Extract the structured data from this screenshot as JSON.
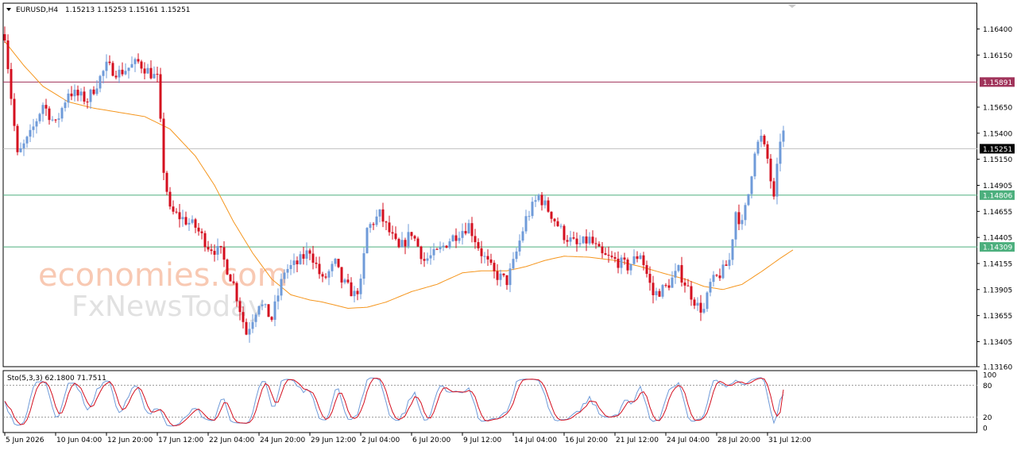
{
  "header": {
    "symbol": "EURUSD,H4",
    "ohlc": "1.15213 1.15253 1.15161 1.15251"
  },
  "watermark": {
    "line1": "economies.com",
    "line2": "FxNewsToday"
  },
  "colors": {
    "bull": "#6f9bd9",
    "bear": "#d40f1f",
    "ma": "#f5961e",
    "resistance": "#a0335a",
    "support": "#4caf7d",
    "current": "#c0c0c0",
    "stoch_main": "#6f9bd9",
    "stoch_signal": "#d40f1f"
  },
  "chart_data": {
    "type": "candlestick",
    "symbol": "EURUSD",
    "timeframe": "H4",
    "ylim": [
      1.1316,
      1.1664
    ],
    "y_ticks": [
      1.164,
      1.1615,
      1.1565,
      1.154,
      1.1515,
      1.149,
      1.1465,
      1.144,
      1.1415,
      1.139,
      1.1365,
      1.134,
      1.1316
    ],
    "y_tick_labels": [
      "1.16400",
      "1.16150",
      "1.15650",
      "1.15400",
      "1.15150",
      "1.14905",
      "1.14655",
      "1.14405",
      "1.14155",
      "1.13905",
      "1.13655",
      "1.13405",
      "1.13160"
    ],
    "x_tick_labels": [
      "5 Jun 2026",
      "10 Jun 04:00",
      "12 Jun 20:00",
      "17 Jun 12:00",
      "22 Jun 04:00",
      "24 Jun 20:00",
      "29 Jun 12:00",
      "2 Jul 04:00",
      "6 Jul 20:00",
      "9 Jul 12:00",
      "14 Jul 04:00",
      "16 Jul 20:00",
      "21 Jul 12:00",
      "24 Jul 04:00",
      "28 Jul 20:00",
      "31 Jul 12:00"
    ],
    "x_tick_positions": [
      0,
      16,
      32,
      48,
      64,
      80,
      96,
      112,
      128,
      144,
      160,
      176,
      192,
      208,
      224,
      240
    ],
    "candles_visible": 246,
    "horizontal_lines": [
      {
        "value": 1.15891,
        "label": "1.15891",
        "role": "resistance"
      },
      {
        "value": 1.15251,
        "label": "1.15251",
        "role": "current"
      },
      {
        "value": 1.14806,
        "label": "1.14806",
        "role": "support"
      },
      {
        "value": 1.14309,
        "label": "1.14309",
        "role": "support"
      }
    ],
    "price_path": [
      [
        0,
        1.1635
      ],
      [
        2,
        1.1575
      ],
      [
        4,
        1.1518
      ],
      [
        8,
        1.1538
      ],
      [
        12,
        1.1568
      ],
      [
        16,
        1.1548
      ],
      [
        20,
        1.158
      ],
      [
        26,
        1.1572
      ],
      [
        32,
        1.1604
      ],
      [
        36,
        1.1598
      ],
      [
        42,
        1.1608
      ],
      [
        48,
        1.1592
      ],
      [
        50,
        1.1505
      ],
      [
        52,
        1.1465
      ],
      [
        56,
        1.1458
      ],
      [
        60,
        1.145
      ],
      [
        64,
        1.1432
      ],
      [
        68,
        1.1425
      ],
      [
        72,
        1.1395
      ],
      [
        76,
        1.1348
      ],
      [
        80,
        1.1378
      ],
      [
        84,
        1.1362
      ],
      [
        88,
        1.1408
      ],
      [
        92,
        1.1415
      ],
      [
        96,
        1.1428
      ],
      [
        100,
        1.1398
      ],
      [
        104,
        1.1415
      ],
      [
        106,
        1.1398
      ],
      [
        110,
        1.1385
      ],
      [
        112,
        1.1395
      ],
      [
        114,
        1.1448
      ],
      [
        118,
        1.1462
      ],
      [
        124,
        1.1428
      ],
      [
        128,
        1.1445
      ],
      [
        132,
        1.1418
      ],
      [
        136,
        1.1425
      ],
      [
        140,
        1.1438
      ],
      [
        146,
        1.1452
      ],
      [
        150,
        1.1425
      ],
      [
        154,
        1.1405
      ],
      [
        158,
        1.1398
      ],
      [
        160,
        1.1415
      ],
      [
        164,
        1.1458
      ],
      [
        168,
        1.148
      ],
      [
        172,
        1.1462
      ],
      [
        176,
        1.1442
      ],
      [
        180,
        1.1432
      ],
      [
        184,
        1.1438
      ],
      [
        188,
        1.1422
      ],
      [
        192,
        1.1418
      ],
      [
        196,
        1.1412
      ],
      [
        200,
        1.1425
      ],
      [
        204,
        1.1385
      ],
      [
        208,
        1.1392
      ],
      [
        212,
        1.1408
      ],
      [
        216,
        1.1385
      ],
      [
        218,
        1.1374
      ],
      [
        220,
        1.137
      ],
      [
        222,
        1.1395
      ],
      [
        226,
        1.1408
      ],
      [
        228,
        1.1418
      ],
      [
        230,
        1.1465
      ],
      [
        232,
        1.1452
      ],
      [
        234,
        1.1482
      ],
      [
        236,
        1.1525
      ],
      [
        238,
        1.1535
      ],
      [
        240,
        1.1515
      ],
      [
        242,
        1.1475
      ],
      [
        244,
        1.1535
      ],
      [
        246,
        1.1545
      ],
      [
        248,
        1.1538
      ],
      [
        250,
        1.1525
      ]
    ],
    "ma_path": [
      [
        0,
        1.1628
      ],
      [
        6,
        1.1605
      ],
      [
        12,
        1.1585
      ],
      [
        20,
        1.157
      ],
      [
        28,
        1.1564
      ],
      [
        36,
        1.156
      ],
      [
        44,
        1.1556
      ],
      [
        52,
        1.1544
      ],
      [
        60,
        1.1518
      ],
      [
        66,
        1.149
      ],
      [
        72,
        1.1455
      ],
      [
        78,
        1.1425
      ],
      [
        84,
        1.14
      ],
      [
        90,
        1.1385
      ],
      [
        96,
        1.138
      ],
      [
        100,
        1.1378
      ],
      [
        108,
        1.1372
      ],
      [
        114,
        1.1373
      ],
      [
        120,
        1.1378
      ],
      [
        128,
        1.1388
      ],
      [
        136,
        1.1395
      ],
      [
        144,
        1.1406
      ],
      [
        150,
        1.1408
      ],
      [
        158,
        1.1408
      ],
      [
        164,
        1.1412
      ],
      [
        170,
        1.1418
      ],
      [
        176,
        1.1422
      ],
      [
        184,
        1.1421
      ],
      [
        192,
        1.1418
      ],
      [
        200,
        1.1412
      ],
      [
        208,
        1.1405
      ],
      [
        214,
        1.14
      ],
      [
        220,
        1.1393
      ],
      [
        226,
        1.139
      ],
      [
        232,
        1.1395
      ],
      [
        238,
        1.1407
      ],
      [
        244,
        1.142
      ],
      [
        248,
        1.1428
      ]
    ],
    "stochastic": {
      "label": "Sto(5,3,3) 62.1800 71.7511",
      "main": 62.18,
      "signal": 71.7511,
      "ylim": [
        0,
        100
      ],
      "tick_labels": [
        "100",
        "80",
        "20",
        "0"
      ],
      "levels": [
        80,
        20
      ]
    }
  }
}
